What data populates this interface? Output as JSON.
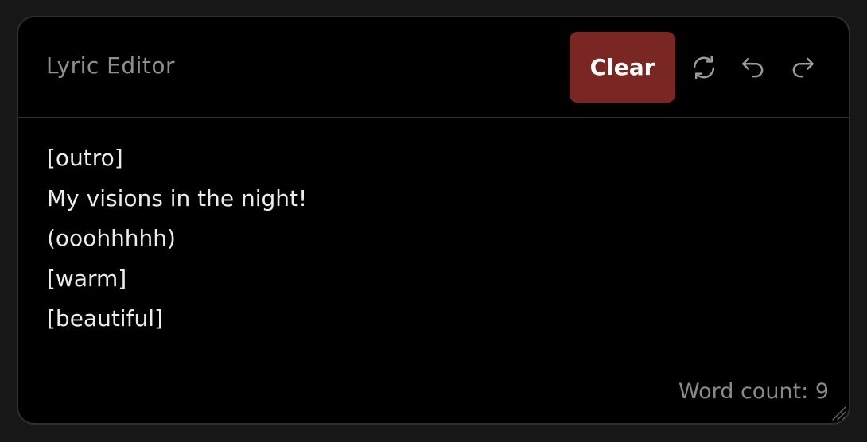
{
  "editor": {
    "title": "Lyric Editor",
    "clear_label": "Clear",
    "clear_color": "#7a2622",
    "icons": [
      "refresh-icon",
      "undo-icon",
      "redo-icon"
    ],
    "lines": [
      "[outro]",
      "My visions in the night!",
      "(ooohhhhh)",
      "[warm]",
      "[beautiful]"
    ],
    "word_count_label": "Word count: 9"
  }
}
